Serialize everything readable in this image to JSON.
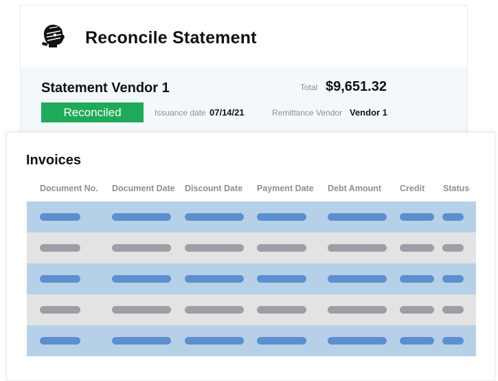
{
  "header": {
    "title": "Reconcile Statement",
    "logo_icon": "person-logo-icon"
  },
  "statement": {
    "vendor": "Statement Vendor 1",
    "total_label": "Total",
    "total_value": "$9,651.32",
    "status": "Reconciled",
    "issuance_label": "Issuance date",
    "issuance_value": "07/14/21",
    "remittance_label": "Remittance Vendor",
    "remittance_value": "Vendor 1"
  },
  "invoices": {
    "title": "Invoices",
    "columns": [
      "Document No.",
      "Document Date",
      "Discount Date",
      "Payment Date",
      "Debt Amount",
      "Credit",
      "Status"
    ],
    "row_styles": [
      "blue",
      "grey",
      "blue",
      "grey",
      "blue"
    ]
  },
  "colors": {
    "accent_green": "#1faa59",
    "row_blue": "#b6d1e7",
    "row_grey": "#e3e3e3",
    "pill_blue": "#5b8fd0",
    "pill_grey": "#9e9ea4"
  }
}
